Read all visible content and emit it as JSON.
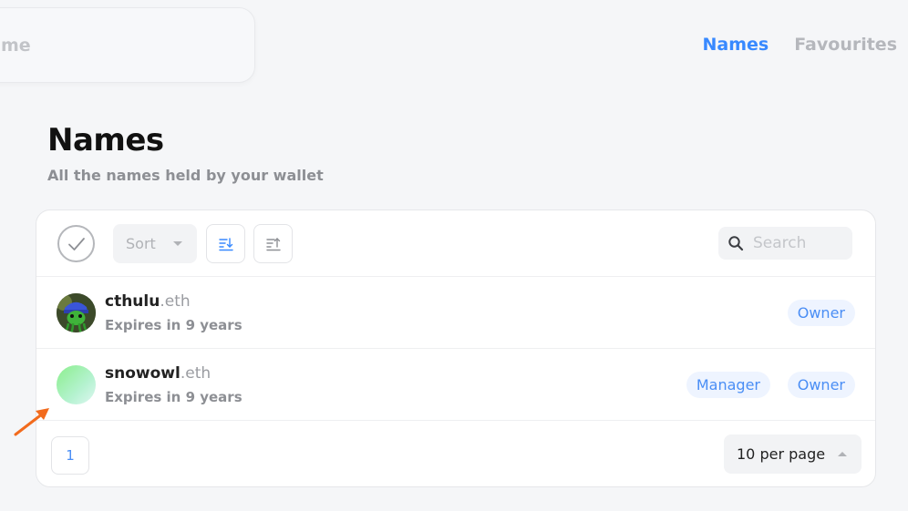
{
  "header": {
    "search_partial_text": "me",
    "nav": {
      "names": "Names",
      "favourites": "Favourites"
    }
  },
  "page": {
    "title": "Names",
    "subtitle": "All the names held by your wallet"
  },
  "toolbar": {
    "sort_label": "Sort",
    "search_placeholder": "Search"
  },
  "names": [
    {
      "label": "cthulu",
      "tld": ".eth",
      "expires": "Expires in 9 years",
      "roles": [
        "Owner"
      ]
    },
    {
      "label": "snowowl",
      "tld": ".eth",
      "expires": "Expires in 9 years",
      "roles": [
        "Manager",
        "Owner"
      ]
    }
  ],
  "footer": {
    "page_number": "1",
    "per_page": "10 per page"
  },
  "colors": {
    "accent": "#3889ff",
    "annotation_arrow": "#f26b1d"
  },
  "icons": [
    "check-circle-icon",
    "chevron-down-icon",
    "sort-descending-icon",
    "sort-ascending-icon",
    "search-icon",
    "chevron-up-icon",
    "arrow-pointer-icon"
  ]
}
